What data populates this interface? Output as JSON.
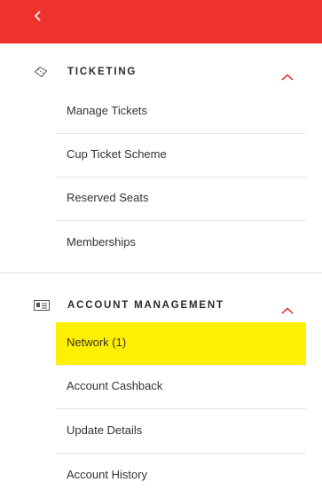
{
  "colors": {
    "topbar": "#ef3430",
    "highlight": "#ffef00",
    "chevron": "#e3221f"
  },
  "topbar": {
    "back_icon": "chevron-left-icon"
  },
  "ticketing": {
    "title": "TICKETING",
    "icon": "ticket-icon",
    "expanded_icon": "chevron-up-icon",
    "items": [
      {
        "label": "Manage Tickets"
      },
      {
        "label": "Cup Ticket Scheme"
      },
      {
        "label": "Reserved Seats"
      },
      {
        "label": "Memberships"
      }
    ]
  },
  "account_management": {
    "title": "ACCOUNT MANAGEMENT",
    "icon": "id-card-icon",
    "expanded_icon": "chevron-up-icon",
    "items": [
      {
        "label": "Network (1)",
        "highlighted": true
      },
      {
        "label": "Account Cashback"
      },
      {
        "label": "Update Details"
      },
      {
        "label": "Account History"
      }
    ]
  }
}
